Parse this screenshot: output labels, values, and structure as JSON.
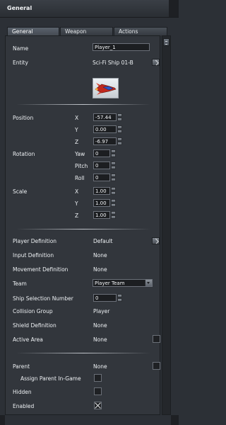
{
  "window": {
    "title": "General"
  },
  "tabs": [
    {
      "label": "General",
      "active": true
    },
    {
      "label": "Weapon",
      "active": false
    },
    {
      "label": "Actions",
      "active": false
    }
  ],
  "props": {
    "name": {
      "label": "Name",
      "value": "Player_1"
    },
    "entity": {
      "label": "Entity",
      "value": "Sci-Fi Ship 01-B"
    },
    "position": {
      "label": "Position",
      "x_label": "X",
      "x": "-57.44",
      "y_label": "Y",
      "y": "0.00",
      "z_label": "Z",
      "z": "-6.97"
    },
    "rotation": {
      "label": "Rotation",
      "yaw_label": "Yaw",
      "yaw": "0",
      "pitch_label": "Pitch",
      "pitch": "0",
      "roll_label": "Roll",
      "roll": "0"
    },
    "scale": {
      "label": "Scale",
      "x_label": "X",
      "x": "1.00",
      "y_label": "Y",
      "y": "1.00",
      "z_label": "Z",
      "z": "1.00"
    },
    "player_definition": {
      "label": "Player Definition",
      "value": "Default"
    },
    "input_definition": {
      "label": "Input Definition",
      "value": "None"
    },
    "movement_definition": {
      "label": "Movement Definition",
      "value": "None"
    },
    "team": {
      "label": "Team",
      "value": "Player Team"
    },
    "ship_selection_number": {
      "label": "Ship Selection Number",
      "value": "0"
    },
    "collision_group": {
      "label": "Collision Group",
      "value": "Player"
    },
    "shield_definition": {
      "label": "Shield Definition",
      "value": "None"
    },
    "active_area": {
      "label": "Active Area",
      "value": "None"
    },
    "parent": {
      "label": "Parent",
      "value": "None"
    },
    "assign_parent": {
      "label": "Assign Parent In-Game",
      "checked": false
    },
    "hidden": {
      "label": "Hidden",
      "checked": false
    },
    "enabled": {
      "label": "Enabled",
      "checked": true
    }
  },
  "icons": {
    "ship": "spaceship-thumbnail-icon",
    "more": "chevron-right-icon",
    "dropdown": "chevron-down-icon"
  },
  "colors": {
    "panel_bg": "#32363c",
    "window_bg": "#2c3036",
    "field_bg": "#1c1e21",
    "ship_red": "#c0281e",
    "ship_blue": "#2a57c9"
  }
}
